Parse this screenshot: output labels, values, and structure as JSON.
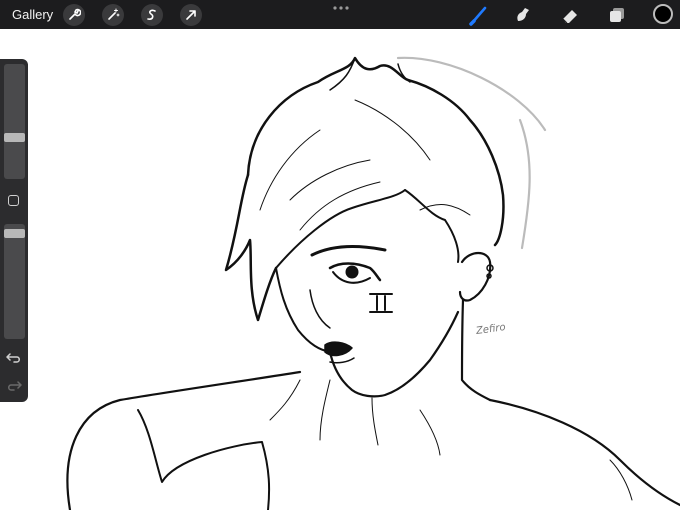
{
  "toolbar": {
    "gallery_label": "Gallery",
    "actions_icon": "wrench-icon",
    "adjustments_icon": "magic-wand-icon",
    "selection_icon": "selection-s-icon",
    "transform_icon": "arrow-cursor-icon",
    "more_icon": "ellipsis-icon",
    "brush_icon": "brush-icon",
    "smudge_icon": "smudge-icon",
    "eraser_icon": "eraser-icon",
    "layers_icon": "layers-icon",
    "active_tool": "brush",
    "active_color": "#000000",
    "accent_color": "#1f7aff"
  },
  "sidebar": {
    "brush_size_level": 0.35,
    "opacity_level": 0.95,
    "modify_icon": "square-modify-icon",
    "undo_icon": "undo-icon",
    "redo_icon": "redo-icon"
  },
  "canvas": {
    "signature_text": "Zefiro",
    "background": "#ffffff"
  }
}
